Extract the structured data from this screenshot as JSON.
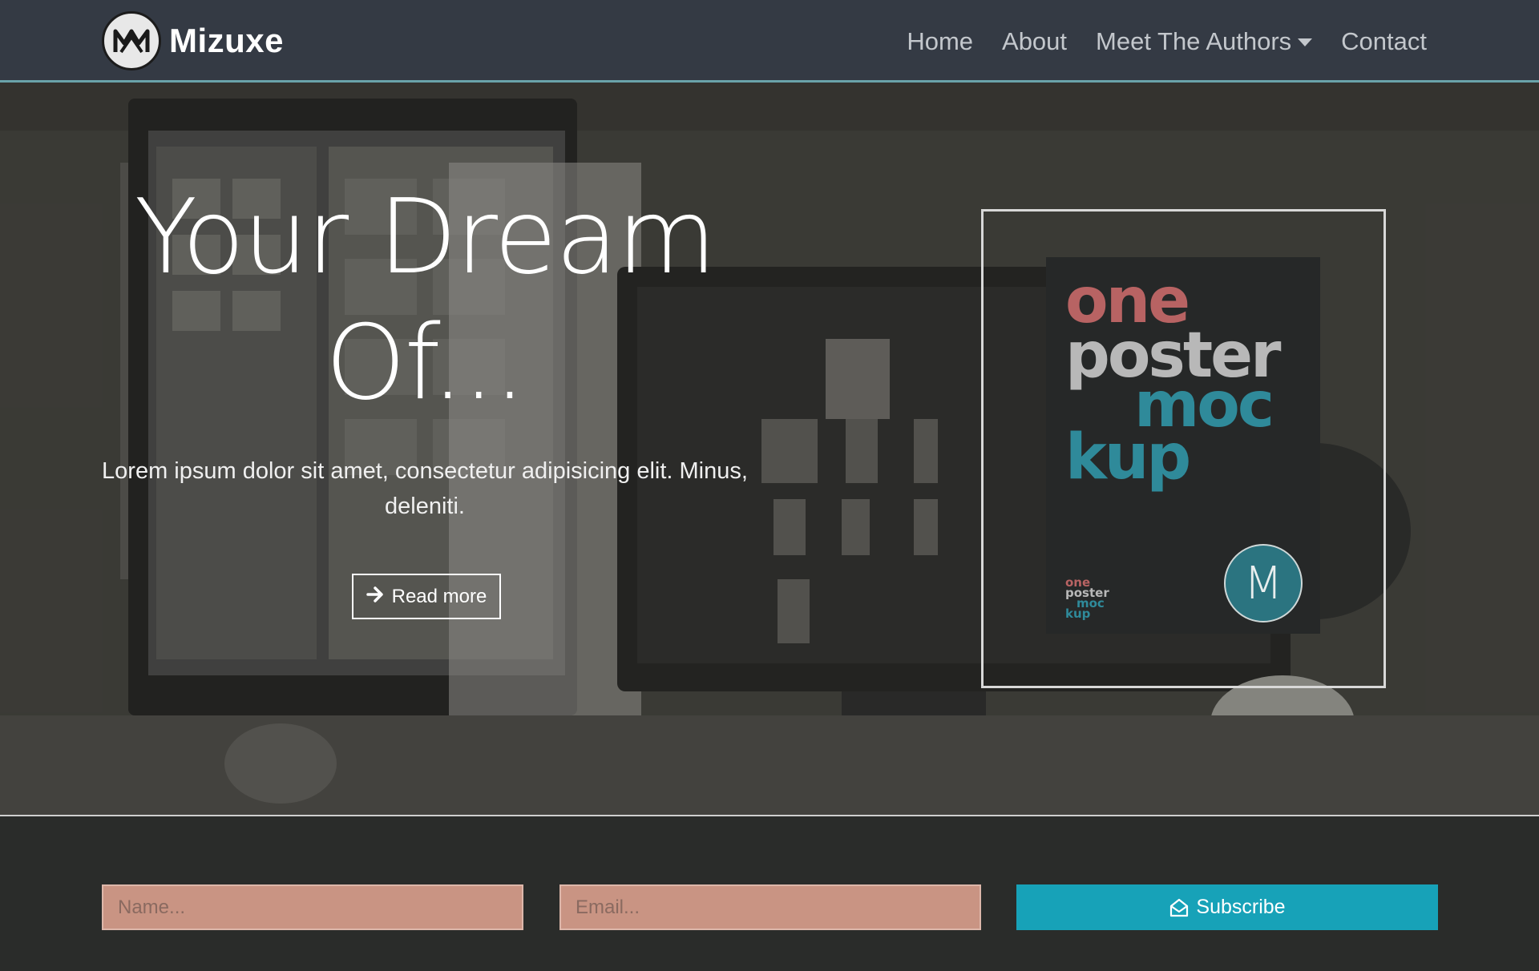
{
  "brand": {
    "name": "Mizuxe",
    "logo_icon": "mizuxe-logo-icon"
  },
  "nav": {
    "items": [
      {
        "label": "Home"
      },
      {
        "label": "About"
      },
      {
        "label": "Meet The Authors",
        "dropdown": true
      },
      {
        "label": "Contact"
      }
    ]
  },
  "hero": {
    "title_line1": "Your Dream",
    "title_line2": "Of...",
    "text": "Lorem ipsum dolor sit amet, consectetur adipisicing elit. Minus, deleniti.",
    "button_label": "Read more",
    "button_icon": "arrow-right-icon"
  },
  "poster": {
    "word1": "one",
    "word2": "poster",
    "word3": "moc",
    "word4": "kup",
    "small1": "one",
    "small2": "poster",
    "small3": "moc",
    "small4": "kup",
    "badge": "M",
    "colors": {
      "one": "#b86363",
      "poster": "#b8b8b8",
      "mockup": "#2f8a9a"
    }
  },
  "subscribe": {
    "name_placeholder": "Name...",
    "email_placeholder": "Email...",
    "button_label": "Subscribe",
    "button_icon": "envelope-open-icon"
  },
  "colors": {
    "navbar_bg": "#343a44",
    "accent": "#17a2b8",
    "input_bg": "#c99483"
  }
}
